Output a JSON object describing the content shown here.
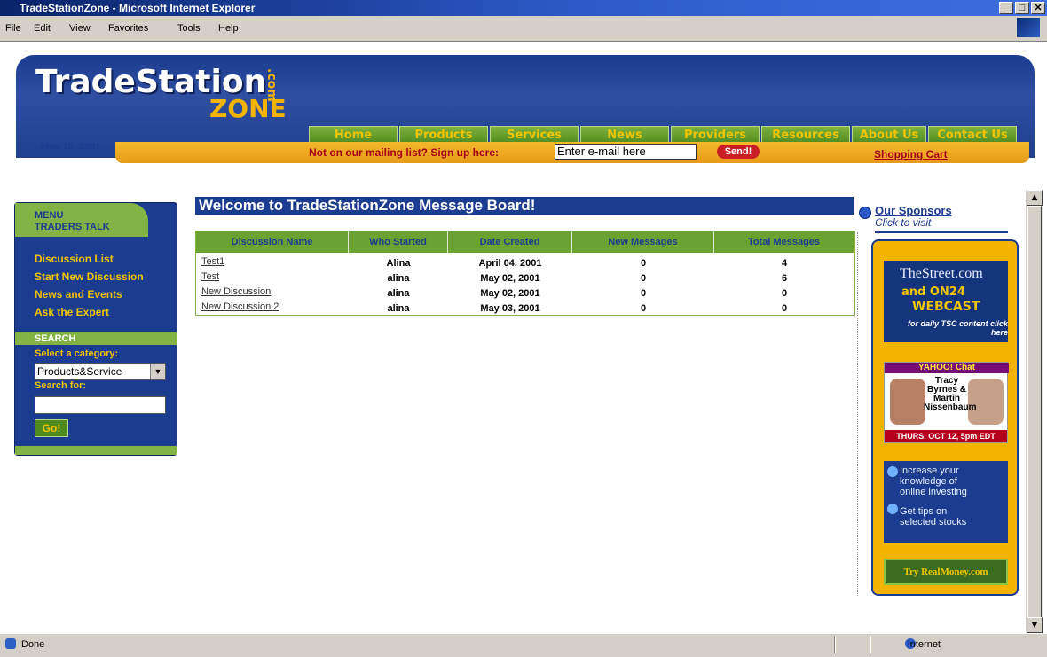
{
  "window": {
    "title": "TradeStationZone - Microsoft Internet Explorer",
    "menu": [
      "File",
      "Edit",
      "View",
      "Favorites",
      "Tools",
      "Help"
    ],
    "minimize": "_",
    "maximize": "□",
    "close": "✕"
  },
  "header": {
    "logo_main": "TradeStation",
    "logo_sub": "ZONE",
    "logo_dotcom": ".com",
    "nav": [
      "Home",
      "Products",
      "Services",
      "News",
      "Providers",
      "Resources",
      "About Us",
      "Contact Us"
    ],
    "date": "May 10, 2001",
    "mailing_text": "Not on our mailing list? Sign up here:",
    "email_placeholder": "Enter e-mail here",
    "send_label": "Send!",
    "shopping_cart": "Shopping Cart"
  },
  "sidebar": {
    "menu_title": "MENU",
    "menu_subtitle": "TRADERS TALK",
    "links": [
      "Discussion List",
      "Start New Discussion",
      "News and Events",
      "Ask the Expert"
    ],
    "search_title": "SEARCH",
    "category_label": "Select a category:",
    "category_value": "Products&Service",
    "search_label": "Search for:",
    "go_label": "Go!"
  },
  "main": {
    "welcome": "Welcome to TradeStationZone Message Board!",
    "columns": [
      "Discussion Name",
      "Who Started",
      "Date Created",
      "New Messages",
      "Total Messages"
    ],
    "rows": [
      {
        "name": "Test1",
        "who": "Alina",
        "date": "April 04, 2001",
        "new": "0",
        "total": "4"
      },
      {
        "name": "Test",
        "who": "alina",
        "date": "May 02, 2001",
        "new": "0",
        "total": "6"
      },
      {
        "name": "New Discussion",
        "who": "alina",
        "date": "May 02, 2001",
        "new": "0",
        "total": "0"
      },
      {
        "name": "New Discussion 2",
        "who": "alina",
        "date": "May 03, 2001",
        "new": "0",
        "total": "0"
      }
    ]
  },
  "sponsors": {
    "title": "Our Sponsors",
    "subtitle": "Click to visit",
    "ad1": {
      "line1": "TheStreet.com",
      "line2": "and ON24",
      "line3": "WEBCAST",
      "line4": "for daily TSC content click here"
    },
    "ad2": {
      "header": "YAHOO! Chat",
      "names": "Tracy Byrnes & Martin Nissenbaum",
      "footer": "THURS. OCT 12, 5pm EDT"
    },
    "ad3": {
      "line1": "Increase your",
      "line2": "knowledge of",
      "line3": "online investing",
      "line4": "Get tips on",
      "line5": "selected stocks"
    },
    "ad4": {
      "text": "Try RealMoney.com"
    }
  },
  "status": {
    "left": "Done",
    "right": "Internet"
  }
}
